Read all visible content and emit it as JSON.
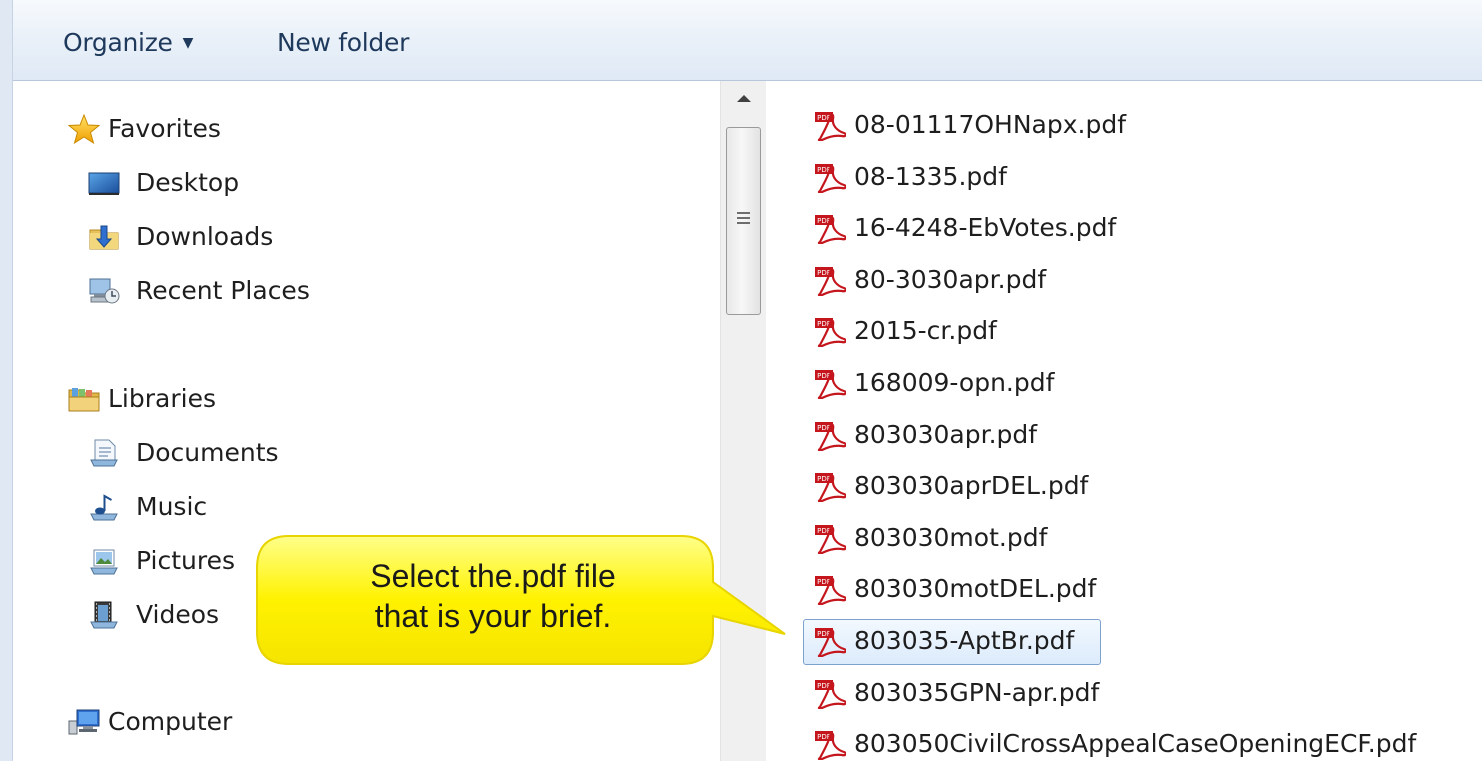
{
  "toolbar": {
    "organize_label": "Organize",
    "new_folder_label": "New folder"
  },
  "nav": {
    "favorites": {
      "label": "Favorites",
      "icon": "star-icon",
      "items": [
        {
          "label": "Desktop",
          "icon": "desktop-icon"
        },
        {
          "label": "Downloads",
          "icon": "downloads-folder-icon"
        },
        {
          "label": "Recent Places",
          "icon": "recent-places-icon"
        }
      ]
    },
    "libraries": {
      "label": "Libraries",
      "icon": "libraries-icon",
      "items": [
        {
          "label": "Documents",
          "icon": "documents-icon"
        },
        {
          "label": "Music",
          "icon": "music-icon"
        },
        {
          "label": "Pictures",
          "icon": "pictures-icon"
        },
        {
          "label": "Videos",
          "icon": "videos-icon"
        }
      ]
    },
    "computer": {
      "label": "Computer",
      "icon": "computer-icon"
    }
  },
  "files": [
    {
      "name": "08-01117OHNapx.pdf",
      "selected": false
    },
    {
      "name": "08-1335.pdf",
      "selected": false
    },
    {
      "name": "16-4248-EbVotes.pdf",
      "selected": false
    },
    {
      "name": "80-3030apr.pdf",
      "selected": false
    },
    {
      "name": "2015-cr.pdf",
      "selected": false
    },
    {
      "name": "168009-opn.pdf",
      "selected": false
    },
    {
      "name": "803030apr.pdf",
      "selected": false
    },
    {
      "name": "803030aprDEL.pdf",
      "selected": false
    },
    {
      "name": "803030mot.pdf",
      "selected": false
    },
    {
      "name": "803030motDEL.pdf",
      "selected": false
    },
    {
      "name": "803035-AptBr.pdf",
      "selected": true
    },
    {
      "name": "803035GPN-apr.pdf",
      "selected": false
    },
    {
      "name": "803050CivilCrossAppealCaseOpeningECF.pdf",
      "selected": false
    }
  ],
  "callout": {
    "line1": "Select the.pdf file",
    "line2": "that is your brief."
  },
  "colors": {
    "toolbar_text": "#1e395b",
    "selection_border": "#7da2ce",
    "callout_fill": "#fff200",
    "pdf_red": "#c4161c"
  }
}
